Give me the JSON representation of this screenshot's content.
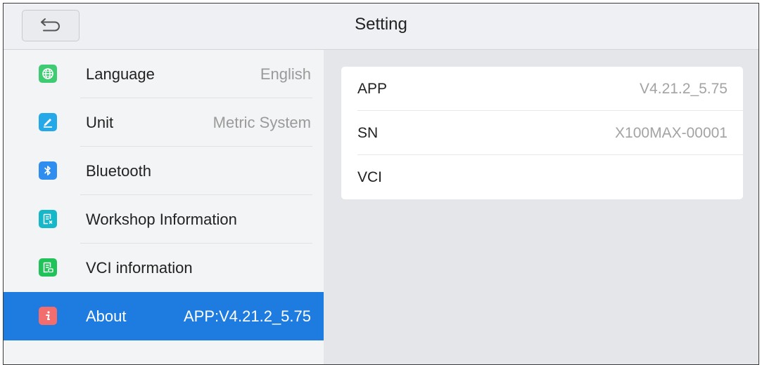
{
  "header": {
    "title": "Setting",
    "back_icon": "return-arrow-icon"
  },
  "sidebar": {
    "items": [
      {
        "label": "Language",
        "value": "English",
        "icon": "globe-icon",
        "icon_color": "#3ecb72"
      },
      {
        "label": "Unit",
        "value": "Metric System",
        "icon": "pencil-icon",
        "icon_color": "#24a8e8"
      },
      {
        "label": "Bluetooth",
        "value": "",
        "icon": "bluetooth-icon",
        "icon_color": "#2f8df0"
      },
      {
        "label": "Workshop Information",
        "value": "",
        "icon": "workshop-info-icon",
        "icon_color": "#16b7c8"
      },
      {
        "label": "VCI information",
        "value": "",
        "icon": "vci-info-icon",
        "icon_color": "#22c25a"
      },
      {
        "label": "About",
        "value": "APP:V4.21.2_5.75",
        "icon": "info-icon",
        "icon_color": "#f26d6d",
        "active": true
      }
    ]
  },
  "details": {
    "rows": [
      {
        "label": "APP",
        "value": "V4.21.2_5.75"
      },
      {
        "label": "SN",
        "value": "X100MAX-00001"
      },
      {
        "label": "VCI",
        "value": ""
      }
    ]
  },
  "colors": {
    "accent": "#1e7be0",
    "background": "#e5e6e9"
  }
}
